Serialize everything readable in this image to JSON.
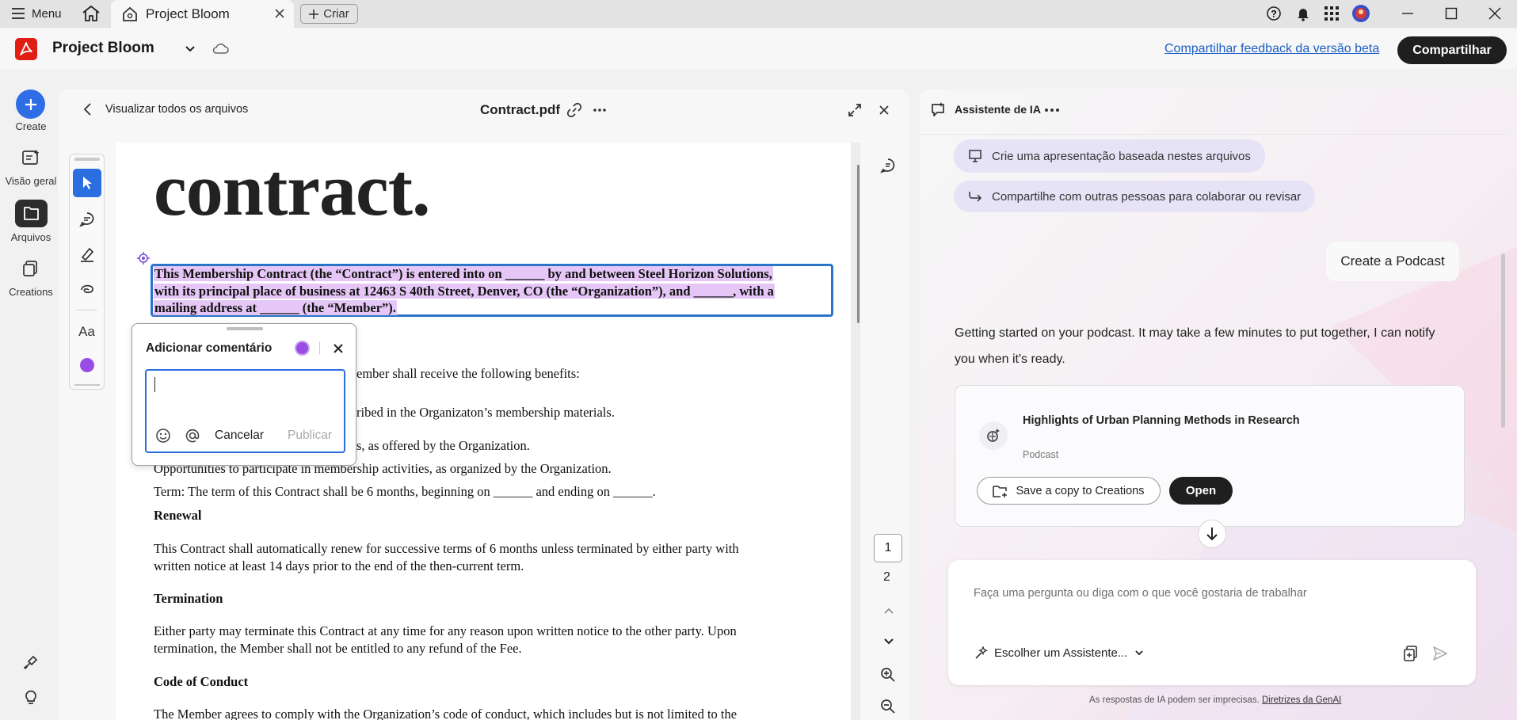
{
  "titlebar": {
    "menu_label": "Menu",
    "tab_title": "Project Bloom",
    "new_tab_label": "Criar"
  },
  "header": {
    "app_title": "Project Bloom",
    "feedback_link": "Compartilhar feedback da versão beta",
    "share_label": "Compartilhar",
    "accent": "#e01e14"
  },
  "rail": {
    "items": [
      {
        "label": "Create",
        "icon": "plus-icon"
      },
      {
        "label": "Visão geral",
        "icon": "overview-icon"
      },
      {
        "label": "Arquivos",
        "icon": "folder-icon"
      },
      {
        "label": "Creations",
        "icon": "creations-icon"
      }
    ]
  },
  "doc": {
    "back_label": "Visualizar todos os arquivos",
    "file_name": "Contract.pdf",
    "heading": "contract.",
    "selected_para": [
      "This Membership Contract (the “Contract”) is entered into on ______ by and between Steel Horizon Solutions,",
      "with its principal place of business at 12463 S 40th Street, Denver, CO (the “Organization”), and ______, with a",
      "mailing address at ______ (the “Member”)."
    ],
    "benefits_intro_tail": "ember shall receive the following benefits:",
    "benefit1_tail": "ribed in the Organizaton’s membership materials.",
    "benefit2_tail": "s, as offered by the Organization.",
    "benefit3": "Opportunities to participate in membership activities, as organized by the Organization.",
    "term": "Term: The term of this Contract shall be 6 months, beginning on ______ and ending on ______.",
    "renewal_heading": "Renewal",
    "renewal_body": [
      "This Contract shall automatically renew for successive terms of 6 months unless terminated by either party with",
      "written notice at least 14 days prior to the end of the then-current term."
    ],
    "termination_heading": "Termination",
    "termination_body": [
      "Either party may terminate this Contract at any time for any reason upon written notice to the other party. Upon",
      "termination, the Member shall not be entitled to any refund of the Fee."
    ],
    "conduct_heading": "Code of Conduct",
    "conduct_body": "The Member agrees to comply with the Organization’s code of conduct, which includes but is not limited to the",
    "pages": [
      "1",
      "2"
    ],
    "current_page": 1
  },
  "comment": {
    "title": "Adicionar comentário",
    "cancel_label": "Cancelar",
    "publish_label": "Publicar",
    "input_value": "",
    "color": "#9a4de6"
  },
  "ai": {
    "title": "Assistente de IA",
    "chips": [
      "Crie uma apresentação baseada nestes arquivos",
      "Compartilhe com outras pessoas para colaborar ou revisar"
    ],
    "user_message": "Create a Podcast",
    "response": [
      "Getting started on your podcast. It may take a few minutes to put together, I can notify",
      "you when it's ready."
    ],
    "podcast": {
      "title": "Highlights of Urban Planning Methods in Research",
      "type": "Podcast",
      "save_label": "Save a copy to Creations",
      "open_label": "Open"
    },
    "input_placeholder": "Faça uma pergunta ou diga com o que você gostaria de trabalhar",
    "assistant_select": "Escolher um Assistente...",
    "disclaimer": "As respostas de IA podem ser imprecisas.",
    "disclaimer_link": "Diretrizes da GenAI"
  }
}
